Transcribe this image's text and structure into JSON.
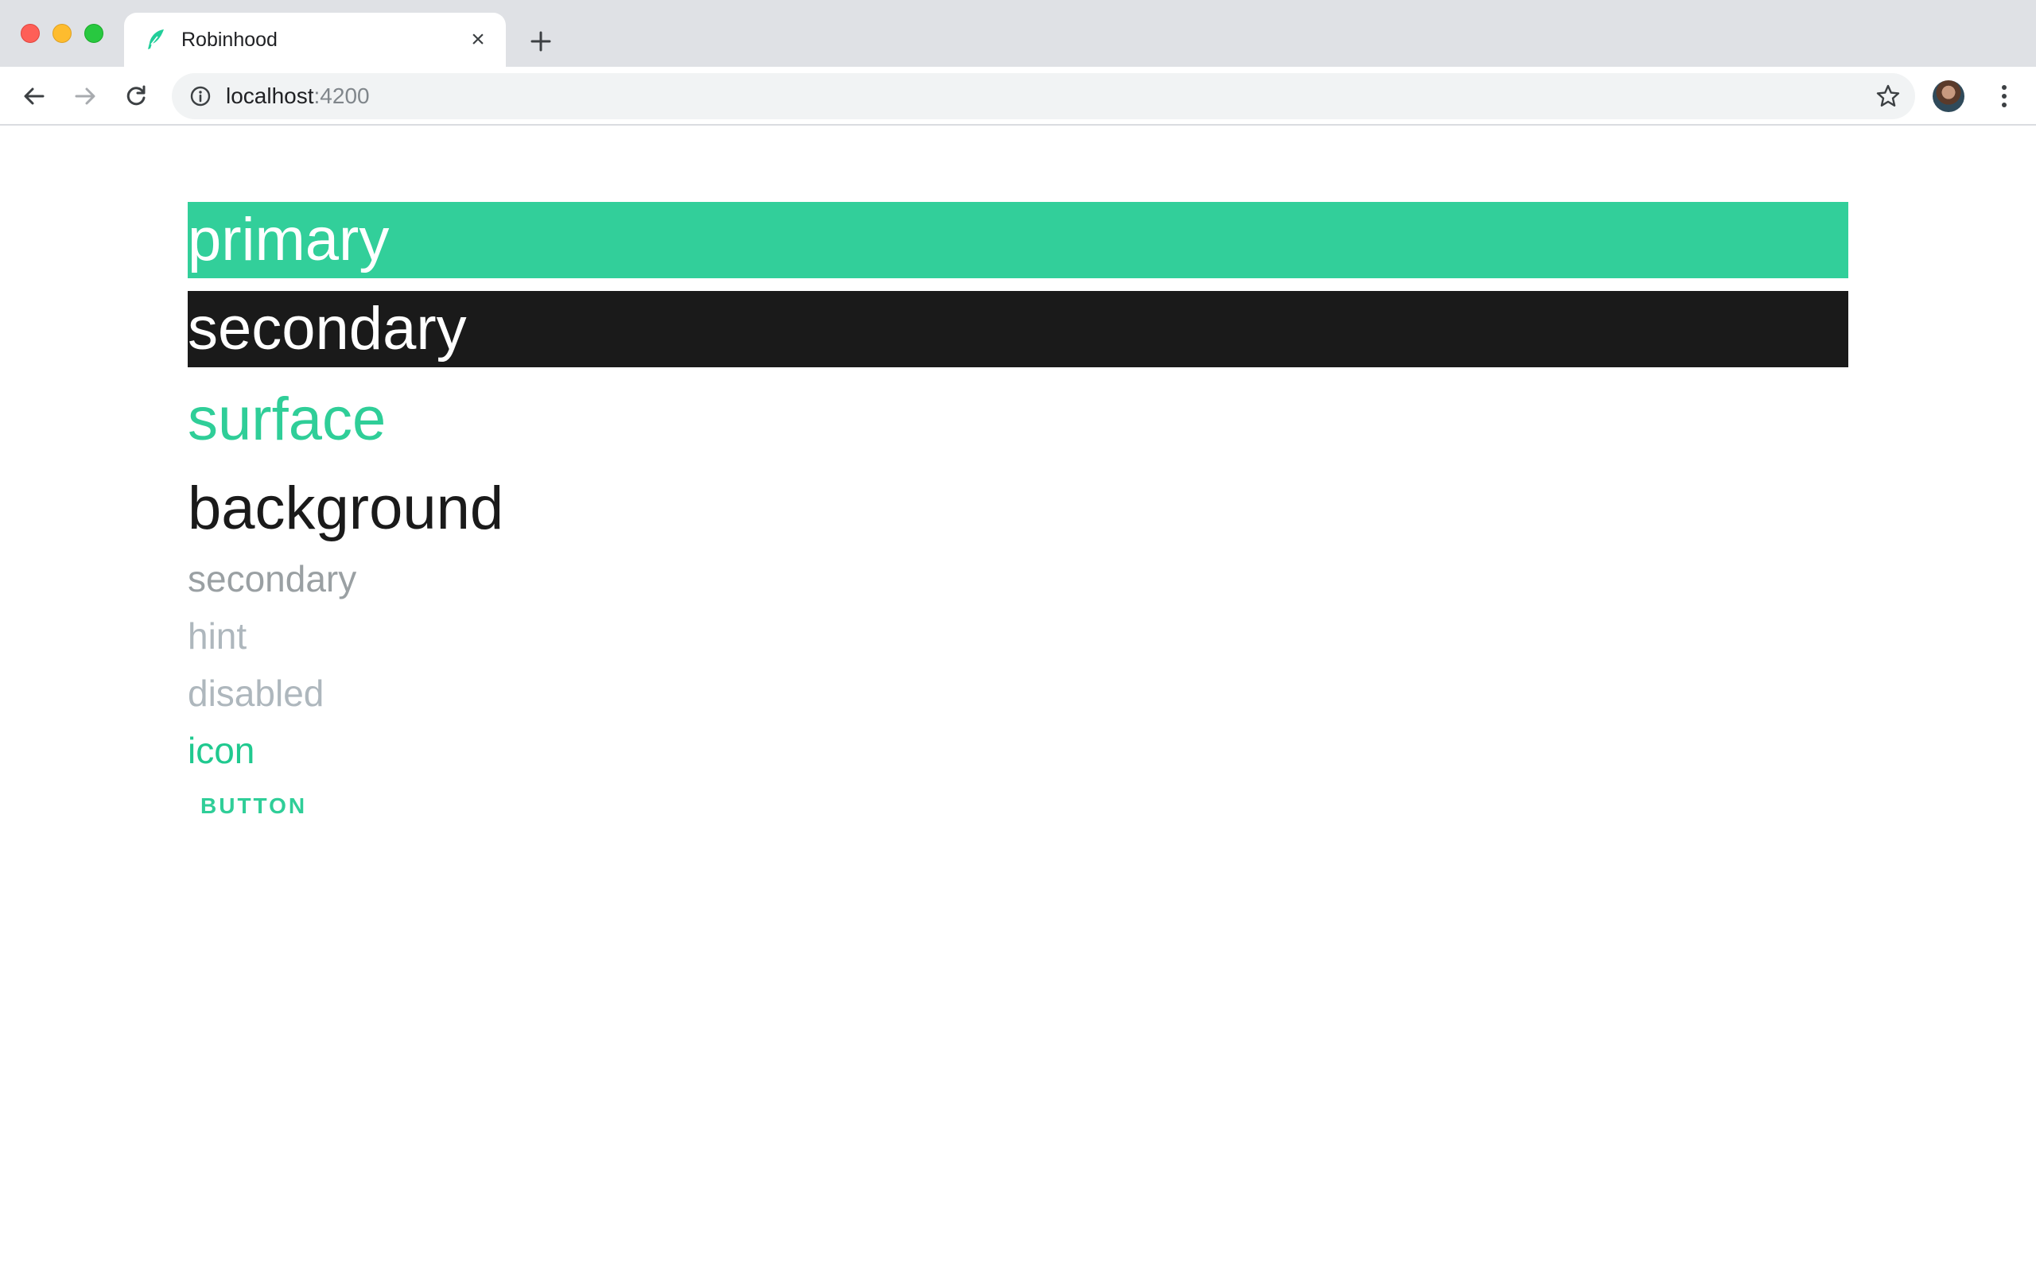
{
  "browser": {
    "tab": {
      "title": "Robinhood",
      "favicon": "feather-icon",
      "close": "×"
    },
    "omnibox": {
      "host": "localhost",
      "port": ":4200"
    }
  },
  "page": {
    "swatches": {
      "primary": "primary",
      "secondary": "secondary",
      "surface": "surface",
      "background": "background"
    },
    "text_styles": {
      "secondary": "secondary",
      "hint": "hint",
      "disabled": "disabled",
      "icon": "icon"
    },
    "button_label": "BUTTON"
  },
  "colors": {
    "primary": "#32cf9a",
    "secondary": "#1a1a1a",
    "surface_text": "#2fce98",
    "background_text": "#1a1a1a",
    "secondary_text": "#9aa0a3",
    "hint_text": "#aeb7bd",
    "disabled_text": "#aeb7bd",
    "icon_text": "#20c98f"
  }
}
